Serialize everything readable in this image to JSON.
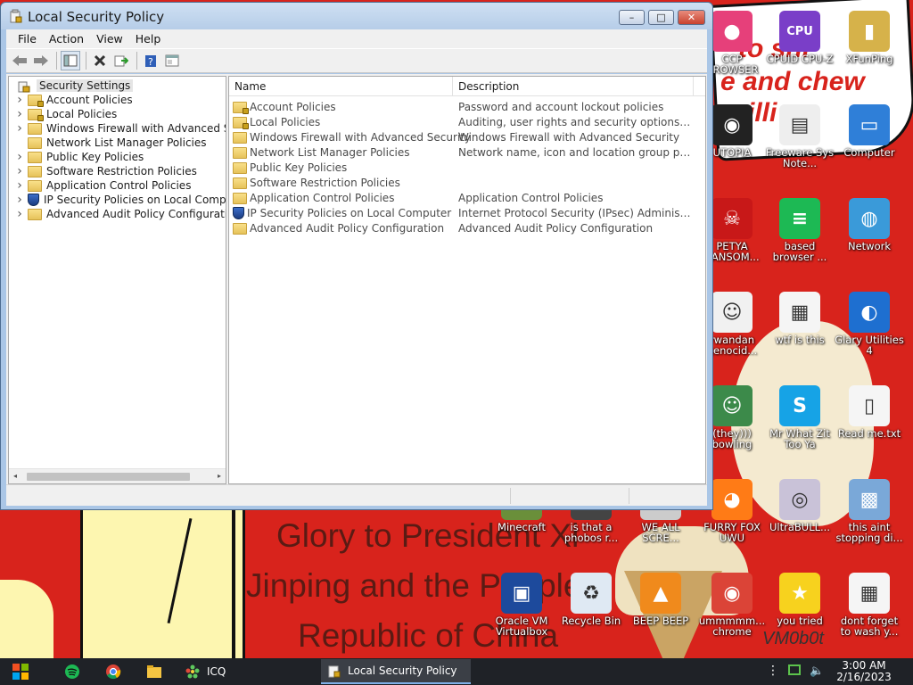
{
  "window": {
    "title": "Local Security Policy",
    "menu": [
      "File",
      "Action",
      "Help",
      "View"
    ],
    "menu_order": [
      0,
      1,
      3,
      2
    ],
    "controls": {
      "minimize": "–",
      "maximize": "□",
      "close": "✕"
    },
    "toolbar_icons": [
      "back-arrow-icon",
      "forward-arrow-icon",
      "show-hide-tree-icon",
      "delete-icon",
      "export-list-icon",
      "help-icon",
      "properties-icon"
    ]
  },
  "tree": {
    "root": "Security Settings",
    "items": [
      {
        "label": "Account Policies",
        "expandable": true,
        "icon": "locked-folder-icon"
      },
      {
        "label": "Local Policies",
        "expandable": true,
        "icon": "locked-folder-icon"
      },
      {
        "label": "Windows Firewall with Advanced Security",
        "expandable": true,
        "icon": "folder-icon"
      },
      {
        "label": "Network List Manager Policies",
        "expandable": false,
        "icon": "folder-icon"
      },
      {
        "label": "Public Key Policies",
        "expandable": true,
        "icon": "folder-icon"
      },
      {
        "label": "Software Restriction Policies",
        "expandable": true,
        "icon": "folder-icon"
      },
      {
        "label": "Application Control Policies",
        "expandable": true,
        "icon": "folder-icon"
      },
      {
        "label": "IP Security Policies on Local Computer",
        "expandable": true,
        "icon": "ipsec-shield-icon"
      },
      {
        "label": "Advanced Audit Policy Configuration",
        "expandable": true,
        "icon": "folder-icon"
      }
    ]
  },
  "list": {
    "columns": [
      "Name",
      "Description"
    ],
    "rows": [
      {
        "name": "Account Policies",
        "description": "Password and account lockout policies",
        "icon": "locked-folder-icon"
      },
      {
        "name": "Local Policies",
        "description": "Auditing, user rights and security options polic...",
        "icon": "locked-folder-icon"
      },
      {
        "name": "Windows Firewall with Advanced Security",
        "description": "Windows Firewall with Advanced Security",
        "icon": "folder-icon"
      },
      {
        "name": "Network List Manager Policies",
        "description": "Network name, icon and location group policies.",
        "icon": "folder-icon"
      },
      {
        "name": "Public Key Policies",
        "description": "",
        "icon": "folder-icon"
      },
      {
        "name": "Software Restriction Policies",
        "description": "",
        "icon": "folder-icon"
      },
      {
        "name": "Application Control Policies",
        "description": "Application Control Policies",
        "icon": "folder-icon"
      },
      {
        "name": "IP Security Policies on Local Computer",
        "description": "Internet Protocol Security (IPsec) Administrati...",
        "icon": "ipsec-shield-icon"
      },
      {
        "name": "Advanced Audit Policy Configuration",
        "description": "Advanced Audit Policy Configuration",
        "icon": "folder-icon"
      }
    ]
  },
  "desktop": {
    "icons": [
      {
        "label": "CCP BROWSER",
        "icon": "browser-icon",
        "color": "#e6407a"
      },
      {
        "label": "CPUID CPU-Z",
        "icon": "cpuz-icon",
        "color": "#7a3ec8"
      },
      {
        "label": "XFunPing",
        "icon": "user-folder-icon",
        "color": "#d6b24a"
      },
      {
        "label": "UTOPIA",
        "icon": "utopia-icon",
        "color": "#222222"
      },
      {
        "label": "Freeware Sys Note...",
        "icon": "document-icon",
        "color": "#eeeeee"
      },
      {
        "label": "Computer",
        "icon": "computer-icon",
        "color": "#2f7fd8"
      },
      {
        "label": "PETYA RANSOM...",
        "icon": "skull-icon",
        "color": "#c81818"
      },
      {
        "label": "based browser ...",
        "icon": "green-chat-icon",
        "color": "#1db954"
      },
      {
        "label": "Network",
        "icon": "network-globe-icon",
        "color": "#3a9ad9"
      },
      {
        "label": "rwandan genocid...",
        "icon": "meme-face-icon",
        "color": "#f1f1f1"
      },
      {
        "label": "wtf is this",
        "icon": "batch-file-icon",
        "color": "#f5f5f5"
      },
      {
        "label": "Glary Utilities 4",
        "icon": "glary-icon",
        "color": "#1e6fd0"
      },
      {
        "label": "(they))) bowling",
        "icon": "bowling-icon",
        "color": "#3c8a4a"
      },
      {
        "label": "Mr What Zit Too Ya",
        "icon": "skype-icon",
        "color": "#16a3e6"
      },
      {
        "label": "Read me.txt",
        "icon": "text-file-icon",
        "color": "#f5f5f5"
      },
      {
        "label": "Minecraft",
        "icon": "minecraft-icon",
        "color": "#6a8f3a"
      },
      {
        "label": "is that a phobos r...",
        "icon": "phobos-icon",
        "color": "#444444"
      },
      {
        "label": "WE ALL SCRE...",
        "icon": "scream-icon",
        "color": "#cccccc"
      },
      {
        "label": "FURRY FOX UWU",
        "icon": "firefox-icon",
        "color": "#ff7b16"
      },
      {
        "label": "UltraBULL...",
        "icon": "disc-icon",
        "color": "#c9c2d8"
      },
      {
        "label": "this aint stopping di...",
        "icon": "computer-tools-icon",
        "color": "#7aa8d8"
      },
      {
        "label": "Oracle VM Virtualbox",
        "icon": "virtualbox-icon",
        "color": "#1d4a9c"
      },
      {
        "label": "Recycle Bin",
        "icon": "recycle-bin-icon",
        "color": "#dfe9f3"
      },
      {
        "label": "BEEP BEEP",
        "icon": "vlc-cone-icon",
        "color": "#f08a1c"
      },
      {
        "label": "ummmmm... chrome",
        "icon": "chrome-icon",
        "color": "#db4437"
      },
      {
        "label": "you tried",
        "icon": "gold-star-icon",
        "color": "#f7d21e"
      },
      {
        "label": "dont forget to wash y...",
        "icon": "batch-file-icon",
        "color": "#f5f5f5"
      }
    ]
  },
  "wallpaper": {
    "slogan": [
      "Glory to President Xi",
      "Jinping and the Peoples",
      "Republic of China"
    ],
    "top_text": [
      "to shi",
      "e and chew",
      "illi"
    ],
    "signature": "VM0b0t"
  },
  "taskbar": {
    "pinned": [
      "spotify-icon",
      "chrome-icon",
      "file-explorer-icon"
    ],
    "tasks": [
      {
        "label": "ICQ",
        "icon": "icq-flower-icon",
        "active": false
      },
      {
        "label": "Local Security Policy",
        "icon": "security-policy-icon",
        "active": true
      }
    ],
    "tray_overflow": "⋮",
    "tray_volume": "🔈",
    "time": "3:00 AM",
    "date": "2/16/2023"
  },
  "colors": {
    "wallpaper_red": "#d8231c",
    "window_frame": "#aac6e6",
    "taskbar": "#1f2227",
    "active_task_underline": "#7fb0e8"
  }
}
